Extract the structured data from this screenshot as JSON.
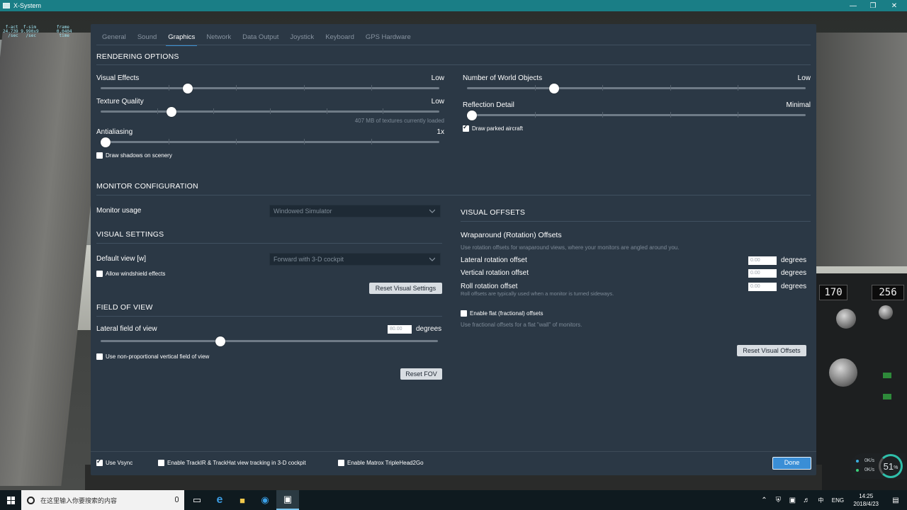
{
  "window": {
    "title": "X-System"
  },
  "hud": {
    "text": " f-act  f-sim        frame\n24.739 9.990x9       0.0404\n  /sec   /sec         time"
  },
  "tabs": [
    "General",
    "Sound",
    "Graphics",
    "Network",
    "Data Output",
    "Joystick",
    "Keyboard",
    "GPS Hardware"
  ],
  "active_tab": "Graphics",
  "rendering": {
    "title": "RENDERING OPTIONS",
    "visual_effects": {
      "label": "Visual Effects",
      "value": "Low",
      "level": 0.25
    },
    "texture_quality": {
      "label": "Texture Quality",
      "value": "Low",
      "level": 0.2,
      "note": "407 MB of textures currently loaded"
    },
    "antialiasing": {
      "label": "Antialiasing",
      "value": "1x",
      "level": 0.0
    },
    "draw_shadows": {
      "label": "Draw shadows on scenery",
      "checked": false
    },
    "world_objects": {
      "label": "Number of World Objects",
      "value": "Low",
      "level": 0.25
    },
    "reflection": {
      "label": "Reflection Detail",
      "value": "Minimal",
      "level": 0.0
    },
    "parked_aircraft": {
      "label": "Draw parked aircraft",
      "checked": true
    }
  },
  "monitor": {
    "title": "MONITOR CONFIGURATION",
    "usage_label": "Monitor usage",
    "usage_value": "Windowed Simulator"
  },
  "visual_settings": {
    "title": "VISUAL SETTINGS",
    "default_view_label": "Default view [w]",
    "default_view_value": "Forward with 3-D cockpit",
    "windshield": {
      "label": "Allow windshield effects",
      "checked": false
    },
    "reset_label": "Reset Visual Settings"
  },
  "fov": {
    "title": "FIELD OF VIEW",
    "lateral_label": "Lateral field of view",
    "lateral_value": "80.00",
    "unit": "degrees",
    "level": 0.35,
    "non_prop": {
      "label": "Use non-proportional vertical field of view",
      "checked": false
    },
    "reset_label": "Reset FOV"
  },
  "visual_offsets": {
    "title": "VISUAL OFFSETS",
    "wrap_title": "Wraparound (Rotation) Offsets",
    "wrap_note": "Use rotation offsets for wraparound views, where your monitors are angled around you.",
    "lateral": {
      "label": "Lateral rotation offset",
      "value": "0.00",
      "unit": "degrees"
    },
    "vertical": {
      "label": "Vertical rotation offset",
      "value": "0.00",
      "unit": "degrees"
    },
    "roll": {
      "label": "Roll rotation offset",
      "value": "0.00",
      "unit": "degrees",
      "note": "Roll offsets are typically used when a monitor is turned sideways."
    },
    "flat": {
      "label": "Enable flat (fractional) offsets",
      "checked": false,
      "note": "Use fractional offsets for a flat \"wall\" of monitors."
    },
    "reset_label": "Reset Visual Offsets"
  },
  "footer": {
    "vsync": {
      "label": "Use Vsync",
      "checked": true
    },
    "trackir": {
      "label": "Enable TrackIR & TrackHat view tracking in 3-D cockpit",
      "checked": false
    },
    "matrox": {
      "label": "Enable Matrox TripleHead2Go",
      "checked": false
    },
    "done_label": "Done"
  },
  "cockpit": {
    "disp1": "170",
    "disp2": "256"
  },
  "netmeter": {
    "up": "0K/s",
    "down": "0K/s",
    "percent": "51",
    "unit": "%"
  },
  "taskbar": {
    "search_placeholder": "在这里输入你要搜索的内容",
    "lang": "ENG",
    "time": "14:25",
    "date": "2018/4/23"
  }
}
